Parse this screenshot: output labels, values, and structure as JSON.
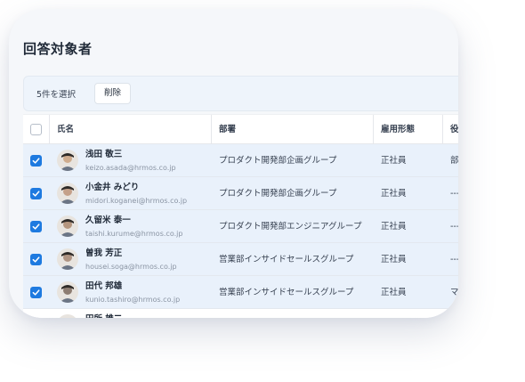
{
  "page": {
    "title": "回答対象者"
  },
  "selection": {
    "count_label": "5件を選択",
    "delete_label": "削除"
  },
  "table": {
    "headers": {
      "name": "氏名",
      "department": "部署",
      "employment": "雇用形態",
      "role": "役職"
    },
    "rows": [
      {
        "selected": true,
        "name": "浅田 敬三",
        "email": "keizo.asada@hrmos.co.jp",
        "department": "プロダクト開発部企画グループ",
        "employment": "正社員",
        "role": "部長",
        "avatar_color": "#c79a73"
      },
      {
        "selected": true,
        "name": "小金井 みどり",
        "email": "midori.koganei@hrmos.co.jp",
        "department": "プロダクト開発部企画グループ",
        "employment": "正社員",
        "role": "---",
        "avatar_color": "#b88a6c"
      },
      {
        "selected": true,
        "name": "久留米 泰一",
        "email": "taishi.kurume@hrmos.co.jp",
        "department": "プロダクト開発部エンジニアグループ",
        "employment": "正社員",
        "role": "---",
        "avatar_color": "#a37b5e"
      },
      {
        "selected": true,
        "name": "曽我 芳正",
        "email": "housei.soga@hrmos.co.jp",
        "department": "営業部インサイドセールスグループ",
        "employment": "正社員",
        "role": "---",
        "avatar_color": "#9c7a64"
      },
      {
        "selected": true,
        "name": "田代 邦雄",
        "email": "kunio.tashiro@hrmos.co.jp",
        "department": "営業部インサイドセールスグループ",
        "employment": "正社員",
        "role": "マ",
        "avatar_color": "#6f5a4c"
      },
      {
        "selected": false,
        "name": "田所 雄二",
        "email": "",
        "department": "営業部インサイドセールスグループ",
        "employment": "正社員",
        "role": "",
        "avatar_color": "#5a4a40"
      }
    ]
  },
  "colors": {
    "accent": "#1e7ae0",
    "selected_row": "#e9f1fb",
    "card_bg": "#f5f7fa"
  }
}
